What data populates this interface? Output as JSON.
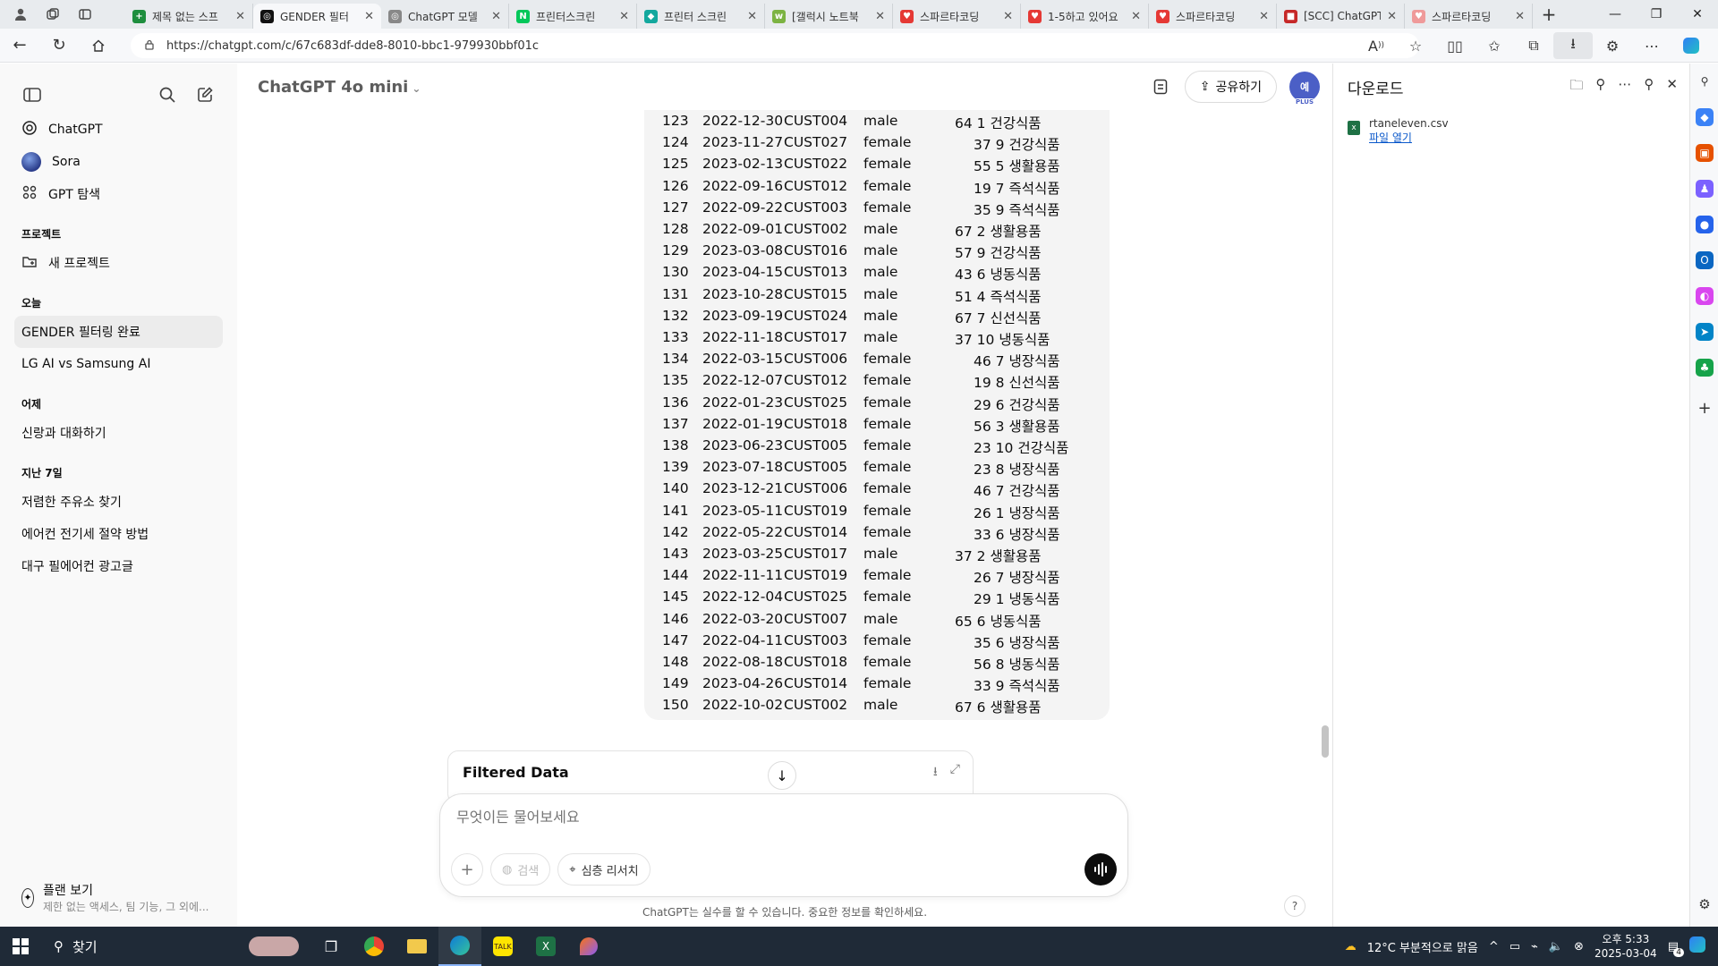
{
  "browser": {
    "tabs": [
      {
        "label": "제목 없는 스프",
        "color": "#1e8e3e",
        "glyph": "+"
      },
      {
        "label": "GENDER 필터",
        "color": "#111111",
        "glyph": "◎",
        "active": true
      },
      {
        "label": "ChatGPT 모델",
        "color": "#888888",
        "glyph": "◎"
      },
      {
        "label": "프린터스크린",
        "color": "#03c75a",
        "glyph": "N"
      },
      {
        "label": "프린터 스크린",
        "color": "#13a89e",
        "glyph": "◆"
      },
      {
        "label": "[갤럭시 노트북",
        "color": "#7cb342",
        "glyph": "w"
      },
      {
        "label": "스파르타코딩",
        "color": "#e53935",
        "glyph": "♥"
      },
      {
        "label": "1-5하고 있어요",
        "color": "#e53935",
        "glyph": "♥"
      },
      {
        "label": "스파르타코딩",
        "color": "#e53935",
        "glyph": "♥"
      },
      {
        "label": "[SCC] ChatGPT",
        "color": "#c62828",
        "glyph": "■"
      },
      {
        "label": "스파르타코딩",
        "color": "#ef9a9a",
        "glyph": "♥"
      }
    ],
    "url": "https://chatgpt.com/c/67c683df-dde8-8010-bbc1-979930bbf01c"
  },
  "sidebar": {
    "nav": [
      {
        "label": "ChatGPT"
      },
      {
        "label": "Sora"
      },
      {
        "label": "GPT 탐색"
      }
    ],
    "projects_header": "프로젝트",
    "new_project": "새 프로젝트",
    "today_header": "오늘",
    "today": [
      "GENDER 필터링 완료",
      "LG AI vs Samsung AI"
    ],
    "yesterday_header": "어제",
    "yesterday": [
      "신랑과 대화하기"
    ],
    "week_header": "지난 7일",
    "week": [
      "저렴한 주유소 찾기",
      "에어컨 전기세 절약 방법",
      "대구 필에어컨 광고글"
    ],
    "plan_title": "플랜 보기",
    "plan_sub": "제한 없는 액세스, 팀 기능, 그 외에..."
  },
  "header": {
    "model": "ChatGPT 4o mini",
    "share": "공유하기",
    "avatar_text": "예",
    "avatar_badge": "PLUS"
  },
  "table_rows": [
    {
      "idx": "123",
      "date": "2022-12-30",
      "cust": "CUST004",
      "gender": "male",
      "age": "64",
      "n": "1",
      "cat": "건강식품"
    },
    {
      "idx": "124",
      "date": "2023-11-27",
      "cust": "CUST027",
      "gender": "female",
      "age": "37",
      "n": "9",
      "cat": "건강식품"
    },
    {
      "idx": "125",
      "date": "2023-02-13",
      "cust": "CUST022",
      "gender": "female",
      "age": "55",
      "n": "5",
      "cat": "생활용품"
    },
    {
      "idx": "126",
      "date": "2022-09-16",
      "cust": "CUST012",
      "gender": "female",
      "age": "19",
      "n": "7",
      "cat": "즉석식품"
    },
    {
      "idx": "127",
      "date": "2022-09-22",
      "cust": "CUST003",
      "gender": "female",
      "age": "35",
      "n": "9",
      "cat": "즉석식품"
    },
    {
      "idx": "128",
      "date": "2022-09-01",
      "cust": "CUST002",
      "gender": "male",
      "age": "67",
      "n": "2",
      "cat": "생활용품"
    },
    {
      "idx": "129",
      "date": "2023-03-08",
      "cust": "CUST016",
      "gender": "male",
      "age": "57",
      "n": "9",
      "cat": "건강식품"
    },
    {
      "idx": "130",
      "date": "2023-04-15",
      "cust": "CUST013",
      "gender": "male",
      "age": "43",
      "n": "6",
      "cat": "냉동식품"
    },
    {
      "idx": "131",
      "date": "2023-10-28",
      "cust": "CUST015",
      "gender": "male",
      "age": "51",
      "n": "4",
      "cat": "즉석식품"
    },
    {
      "idx": "132",
      "date": "2023-09-19",
      "cust": "CUST024",
      "gender": "male",
      "age": "67",
      "n": "7",
      "cat": "신선식품"
    },
    {
      "idx": "133",
      "date": "2022-11-18",
      "cust": "CUST017",
      "gender": "male",
      "age": "37",
      "n": "10",
      "cat": "냉동식품"
    },
    {
      "idx": "134",
      "date": "2022-03-15",
      "cust": "CUST006",
      "gender": "female",
      "age": "46",
      "n": "7",
      "cat": "냉장식품"
    },
    {
      "idx": "135",
      "date": "2022-12-07",
      "cust": "CUST012",
      "gender": "female",
      "age": "19",
      "n": "8",
      "cat": "신선식품"
    },
    {
      "idx": "136",
      "date": "2022-01-23",
      "cust": "CUST025",
      "gender": "female",
      "age": "29",
      "n": "6",
      "cat": "건강식품"
    },
    {
      "idx": "137",
      "date": "2022-01-19",
      "cust": "CUST018",
      "gender": "female",
      "age": "56",
      "n": "3",
      "cat": "생활용품"
    },
    {
      "idx": "138",
      "date": "2023-06-23",
      "cust": "CUST005",
      "gender": "female",
      "age": "23",
      "n": "10",
      "cat": "건강식품"
    },
    {
      "idx": "139",
      "date": "2023-07-18",
      "cust": "CUST005",
      "gender": "female",
      "age": "23",
      "n": "8",
      "cat": "냉장식품"
    },
    {
      "idx": "140",
      "date": "2023-12-21",
      "cust": "CUST006",
      "gender": "female",
      "age": "46",
      "n": "7",
      "cat": "건강식품"
    },
    {
      "idx": "141",
      "date": "2023-05-11",
      "cust": "CUST019",
      "gender": "female",
      "age": "26",
      "n": "1",
      "cat": "냉장식품"
    },
    {
      "idx": "142",
      "date": "2022-05-22",
      "cust": "CUST014",
      "gender": "female",
      "age": "33",
      "n": "6",
      "cat": "냉장식품"
    },
    {
      "idx": "143",
      "date": "2023-03-25",
      "cust": "CUST017",
      "gender": "male",
      "age": "37",
      "n": "2",
      "cat": "생활용품"
    },
    {
      "idx": "144",
      "date": "2022-11-11",
      "cust": "CUST019",
      "gender": "female",
      "age": "26",
      "n": "7",
      "cat": "냉장식품"
    },
    {
      "idx": "145",
      "date": "2022-12-04",
      "cust": "CUST025",
      "gender": "female",
      "age": "29",
      "n": "1",
      "cat": "냉동식품"
    },
    {
      "idx": "146",
      "date": "2022-03-20",
      "cust": "CUST007",
      "gender": "male",
      "age": "65",
      "n": "6",
      "cat": "냉동식품"
    },
    {
      "idx": "147",
      "date": "2022-04-11",
      "cust": "CUST003",
      "gender": "female",
      "age": "35",
      "n": "6",
      "cat": "냉장식품"
    },
    {
      "idx": "148",
      "date": "2022-08-18",
      "cust": "CUST018",
      "gender": "female",
      "age": "56",
      "n": "8",
      "cat": "냉동식품"
    },
    {
      "idx": "149",
      "date": "2023-04-26",
      "cust": "CUST014",
      "gender": "female",
      "age": "33",
      "n": "9",
      "cat": "즉석식품"
    },
    {
      "idx": "150",
      "date": "2022-10-02",
      "cust": "CUST002",
      "gender": "male",
      "age": "67",
      "n": "6",
      "cat": "생활용품"
    }
  ],
  "filtered_data_title": "Filtered Data",
  "composer": {
    "placeholder": "무엇이든 물어보세요",
    "search": "검색",
    "deep_research": "심층 리서치"
  },
  "disclaimer": "ChatGPT는 실수를 할 수 있습니다. 중요한 정보를 확인하세요.",
  "help": "?",
  "downloads": {
    "title": "다운로드",
    "file_name": "rtaneleven.csv",
    "open_link": "파일 열기"
  },
  "taskbar": {
    "search": "찾기",
    "weather": "12°C 부분적으로 맑음",
    "time": "오후 5:33",
    "date": "2025-03-04",
    "notif_count": "4"
  }
}
